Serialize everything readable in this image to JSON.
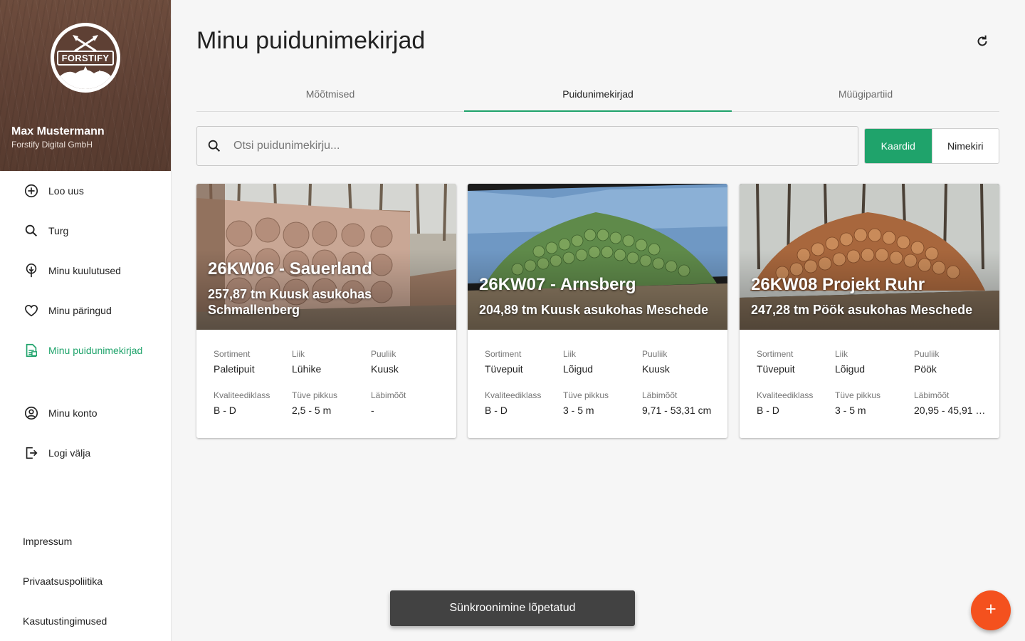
{
  "sidebar": {
    "logo_text": "FORSTIFY",
    "user_name": "Max Mustermann",
    "company": "Forstify Digital GmbH",
    "nav": [
      {
        "label": "Loo uus",
        "icon": "add-circle-icon"
      },
      {
        "label": "Turg",
        "icon": "search-icon"
      },
      {
        "label": "Minu kuulutused",
        "icon": "tree-icon"
      },
      {
        "label": "Minu päringud",
        "icon": "heart-icon"
      },
      {
        "label": "Minu puidunimekirjad",
        "icon": "document-icon",
        "active": true
      },
      {
        "label": "Minu konto",
        "icon": "account-icon"
      },
      {
        "label": "Logi välja",
        "icon": "logout-icon"
      }
    ],
    "footer": [
      "Impressum",
      "Privaatsuspoliitika",
      "Kasutustingimused"
    ]
  },
  "header": {
    "title": "Minu puidunimekirjad",
    "refresh_icon": "refresh-icon"
  },
  "tabs": [
    {
      "label": "Mõõtmised"
    },
    {
      "label": "Puidunimekirjad",
      "active": true
    },
    {
      "label": "Müügipartiid"
    }
  ],
  "search": {
    "placeholder": "Otsi puidunimekirju..."
  },
  "view_toggle": {
    "cards": "Kaardid",
    "list": "Nimekiri",
    "selected": "Kaardid"
  },
  "cards": [
    {
      "title": "26KW06 - Sauerland",
      "subtitle": "257,87 tm Kuusk asukohas Schmallenberg",
      "props": [
        {
          "label": "Sortiment",
          "value": "Paletipuit"
        },
        {
          "label": "Liik",
          "value": "Lühike"
        },
        {
          "label": "Puuliik",
          "value": "Kuusk"
        },
        {
          "label": "Kvaliteediklass",
          "value": "B - D"
        },
        {
          "label": "Tüve pikkus",
          "value": "2,5 - 5 m"
        },
        {
          "label": "Läbimõõt",
          "value": "-"
        }
      ]
    },
    {
      "title": "26KW07 - Arnsberg",
      "subtitle": "204,89 tm Kuusk asukohas Meschede",
      "props": [
        {
          "label": "Sortiment",
          "value": "Tüvepuit"
        },
        {
          "label": "Liik",
          "value": "Lõigud"
        },
        {
          "label": "Puuliik",
          "value": "Kuusk"
        },
        {
          "label": "Kvaliteediklass",
          "value": "B - D"
        },
        {
          "label": "Tüve pikkus",
          "value": "3 - 5 m"
        },
        {
          "label": "Läbimõõt",
          "value": "9,71 - 53,31 cm"
        }
      ]
    },
    {
      "title": "26KW08 Projekt Ruhr",
      "subtitle": "247,28 tm Pöök asukohas Meschede",
      "props": [
        {
          "label": "Sortiment",
          "value": "Tüvepuit"
        },
        {
          "label": "Liik",
          "value": "Lõigud"
        },
        {
          "label": "Puuliik",
          "value": "Pöök"
        },
        {
          "label": "Kvaliteediklass",
          "value": "B - D"
        },
        {
          "label": "Tüve pikkus",
          "value": "3 - 5 m"
        },
        {
          "label": "Läbimõõt",
          "value": "20,95 - 45,91 …"
        }
      ]
    }
  ],
  "snackbar": "Sünkroonimine lõpetatud",
  "fab_icon": "plus-icon",
  "colors": {
    "accent": "#1fa36b",
    "fab": "#f4511e",
    "profile_bg": "#5e4034",
    "snackbar": "#424242"
  }
}
